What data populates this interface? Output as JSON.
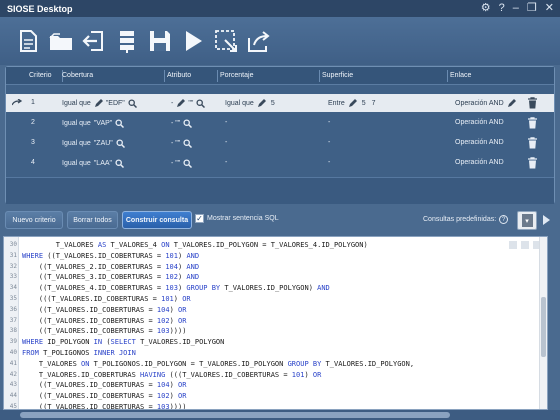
{
  "window": {
    "title": "SIOSE Desktop"
  },
  "table": {
    "headers": [
      "Criterio",
      "Cobertura",
      "Atributo",
      "Porcentaje",
      "Superficie",
      "Enlace"
    ],
    "rows": [
      {
        "num": "1",
        "cobertura": "Igual que",
        "cob_val": "\"EDF\"",
        "atributo": "- \"\"",
        "porcentaje": "Igual que",
        "pct_val": "5",
        "superficie": "Entre",
        "sup_a": "5",
        "sup_b": "7",
        "enlace": "Operación AND",
        "selected": true
      },
      {
        "num": "2",
        "cobertura": "Igual que",
        "cob_val": "\"VAP\"",
        "atributo": "- \"\"",
        "porcentaje": "-",
        "pct_val": "",
        "superficie": "-",
        "sup_a": "",
        "sup_b": "",
        "enlace": "Operación AND",
        "selected": false
      },
      {
        "num": "3",
        "cobertura": "Igual que",
        "cob_val": "\"ZAU\"",
        "atributo": "- \"\"",
        "porcentaje": "-",
        "pct_val": "",
        "superficie": "-",
        "sup_a": "",
        "sup_b": "",
        "enlace": "Operación AND",
        "selected": false
      },
      {
        "num": "4",
        "cobertura": "Igual que",
        "cob_val": "\"LAA\"",
        "atributo": "- \"\"",
        "porcentaje": "-",
        "pct_val": "",
        "superficie": "-",
        "sup_a": "",
        "sup_b": "",
        "enlace": "Operación AND",
        "selected": false
      }
    ]
  },
  "controls": {
    "nuevo": "Nuevo criterio",
    "borrar": "Borrar todos",
    "construir": "Construir consulta",
    "mostrar": "Mostrar sentencia SQL",
    "mostrar_checked": true,
    "consultas": "Consultas predefinidas:",
    "help": "?"
  },
  "editor": {
    "lines": [
      {
        "n": "30",
        "code": "        T_VALORES AS T_VALORES_4 ON T_VALORES.ID_POLYGON = T_VALORES_4.ID_POLYGON)"
      },
      {
        "n": "31",
        "code": "WHERE ((T_VALORES.ID_COBERTURAS = 101) AND"
      },
      {
        "n": "32",
        "code": "    ((T_VALORES_2.ID_COBERTURAS = 104) AND"
      },
      {
        "n": "33",
        "code": "    ((T_VALORES_3.ID_COBERTURAS = 102) AND"
      },
      {
        "n": "34",
        "code": "    ((T_VALORES_4.ID_COBERTURAS = 103) GROUP BY T_VALORES.ID_POLYGON) AND"
      },
      {
        "n": "35",
        "code": "    (((T_VALORES.ID_COBERTURAS = 101) OR"
      },
      {
        "n": "36",
        "code": "    ((T_VALORES.ID_COBERTURAS = 104) OR"
      },
      {
        "n": "37",
        "code": "    ((T_VALORES.ID_COBERTURAS = 102) OR"
      },
      {
        "n": "38",
        "code": "    ((T_VALORES.ID_COBERTURAS = 103))))"
      },
      {
        "n": "39",
        "code": "WHERE ID_POLYGON IN (SELECT T_VALORES.ID_POLYGON"
      },
      {
        "n": "40",
        "code": "FROM T_POLIGONOS INNER JOIN"
      },
      {
        "n": "41",
        "code": "    T_VALORES ON T_POLIGONOS.ID_POLYGON = T_VALORES.ID_POLYGON GROUP BY T_VALORES.ID_POLYGON,"
      },
      {
        "n": "42",
        "code": "    T_VALORES.ID_COBERTURAS HAVING (((T_VALORES.ID_COBERTURAS = 101) OR"
      },
      {
        "n": "43",
        "code": "    ((T_VALORES.ID_COBERTURAS = 104) OR"
      },
      {
        "n": "44",
        "code": "    ((T_VALORES.ID_COBERTURAS = 102) OR"
      },
      {
        "n": "45",
        "code": "    ((T_VALORES.ID_COBERTURAS = 103))))"
      }
    ]
  },
  "icons": {
    "toolbar": [
      "new-document-icon",
      "open-folder-icon",
      "import-icon",
      "database-icon",
      "save-icon",
      "run-icon",
      "edit-icon",
      "export-icon"
    ],
    "window": [
      "settings-icon",
      "help-icon",
      "minimize-icon",
      "restore-icon",
      "close-icon"
    ]
  }
}
